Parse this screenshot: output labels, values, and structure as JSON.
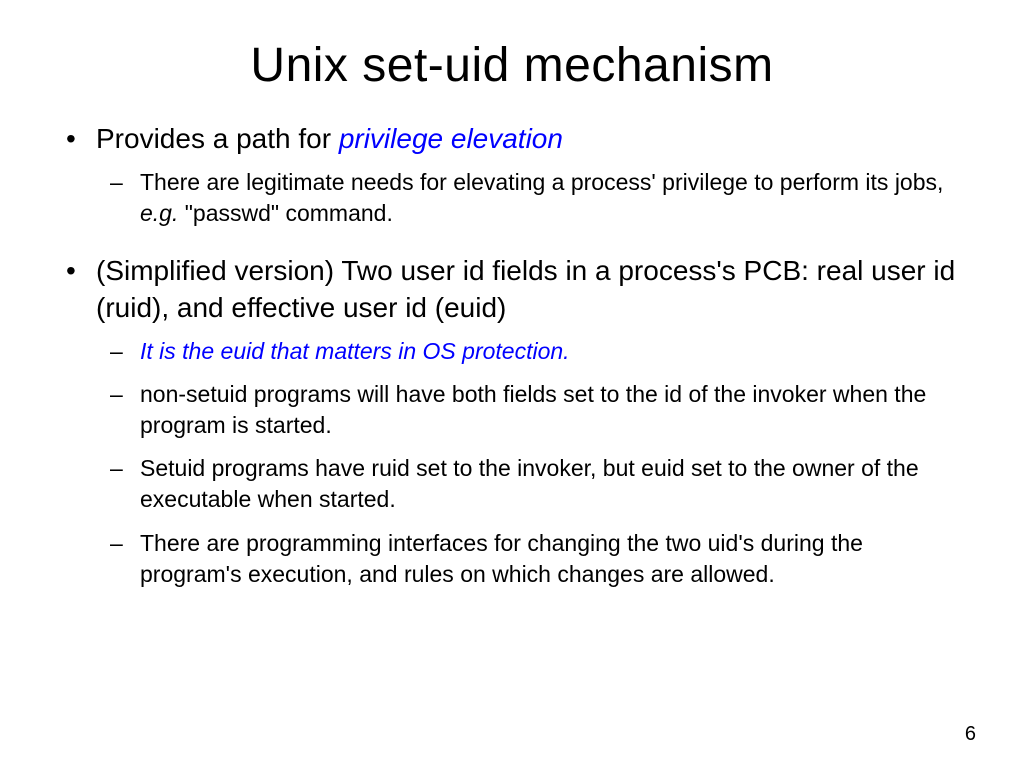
{
  "title": "Unix set-uid mechanism",
  "bullets": [
    {
      "text_before": "Provides a path for ",
      "highlight": "privilege elevation",
      "sub": [
        {
          "parts": [
            {
              "t": "There are legitimate needs for elevating a process"
            },
            {
              "t": "'"
            },
            {
              "t": " privilege to perform its jobs, "
            },
            {
              "t": "e.g.",
              "italic": true
            },
            {
              "t": " \"passwd\" command."
            }
          ]
        }
      ]
    },
    {
      "text_before": "(Simplified version) Two user id fields in a process",
      "apos": "'",
      "text_after": "s PCB: real user id (ruid), and effective user id (euid)",
      "sub": [
        {
          "parts": [
            {
              "t": "It is the euid that matters in OS protection.",
              "italic": true,
              "blue": true
            }
          ]
        },
        {
          "parts": [
            {
              "t": "non-setuid programs will have both fields set to the id of the invoker when the program is started."
            }
          ]
        },
        {
          "parts": [
            {
              "t": "Setuid programs have ruid set to the invoker, but euid set to the owner of the executable when started."
            }
          ]
        },
        {
          "parts": [
            {
              "t": "There are programming interfaces for changing the two uid"
            },
            {
              "t": "'"
            },
            {
              "t": "s during the program"
            },
            {
              "t": "'"
            },
            {
              "t": "s execution, and rules on which changes are allowed."
            }
          ]
        }
      ]
    }
  ],
  "page_number": "6"
}
